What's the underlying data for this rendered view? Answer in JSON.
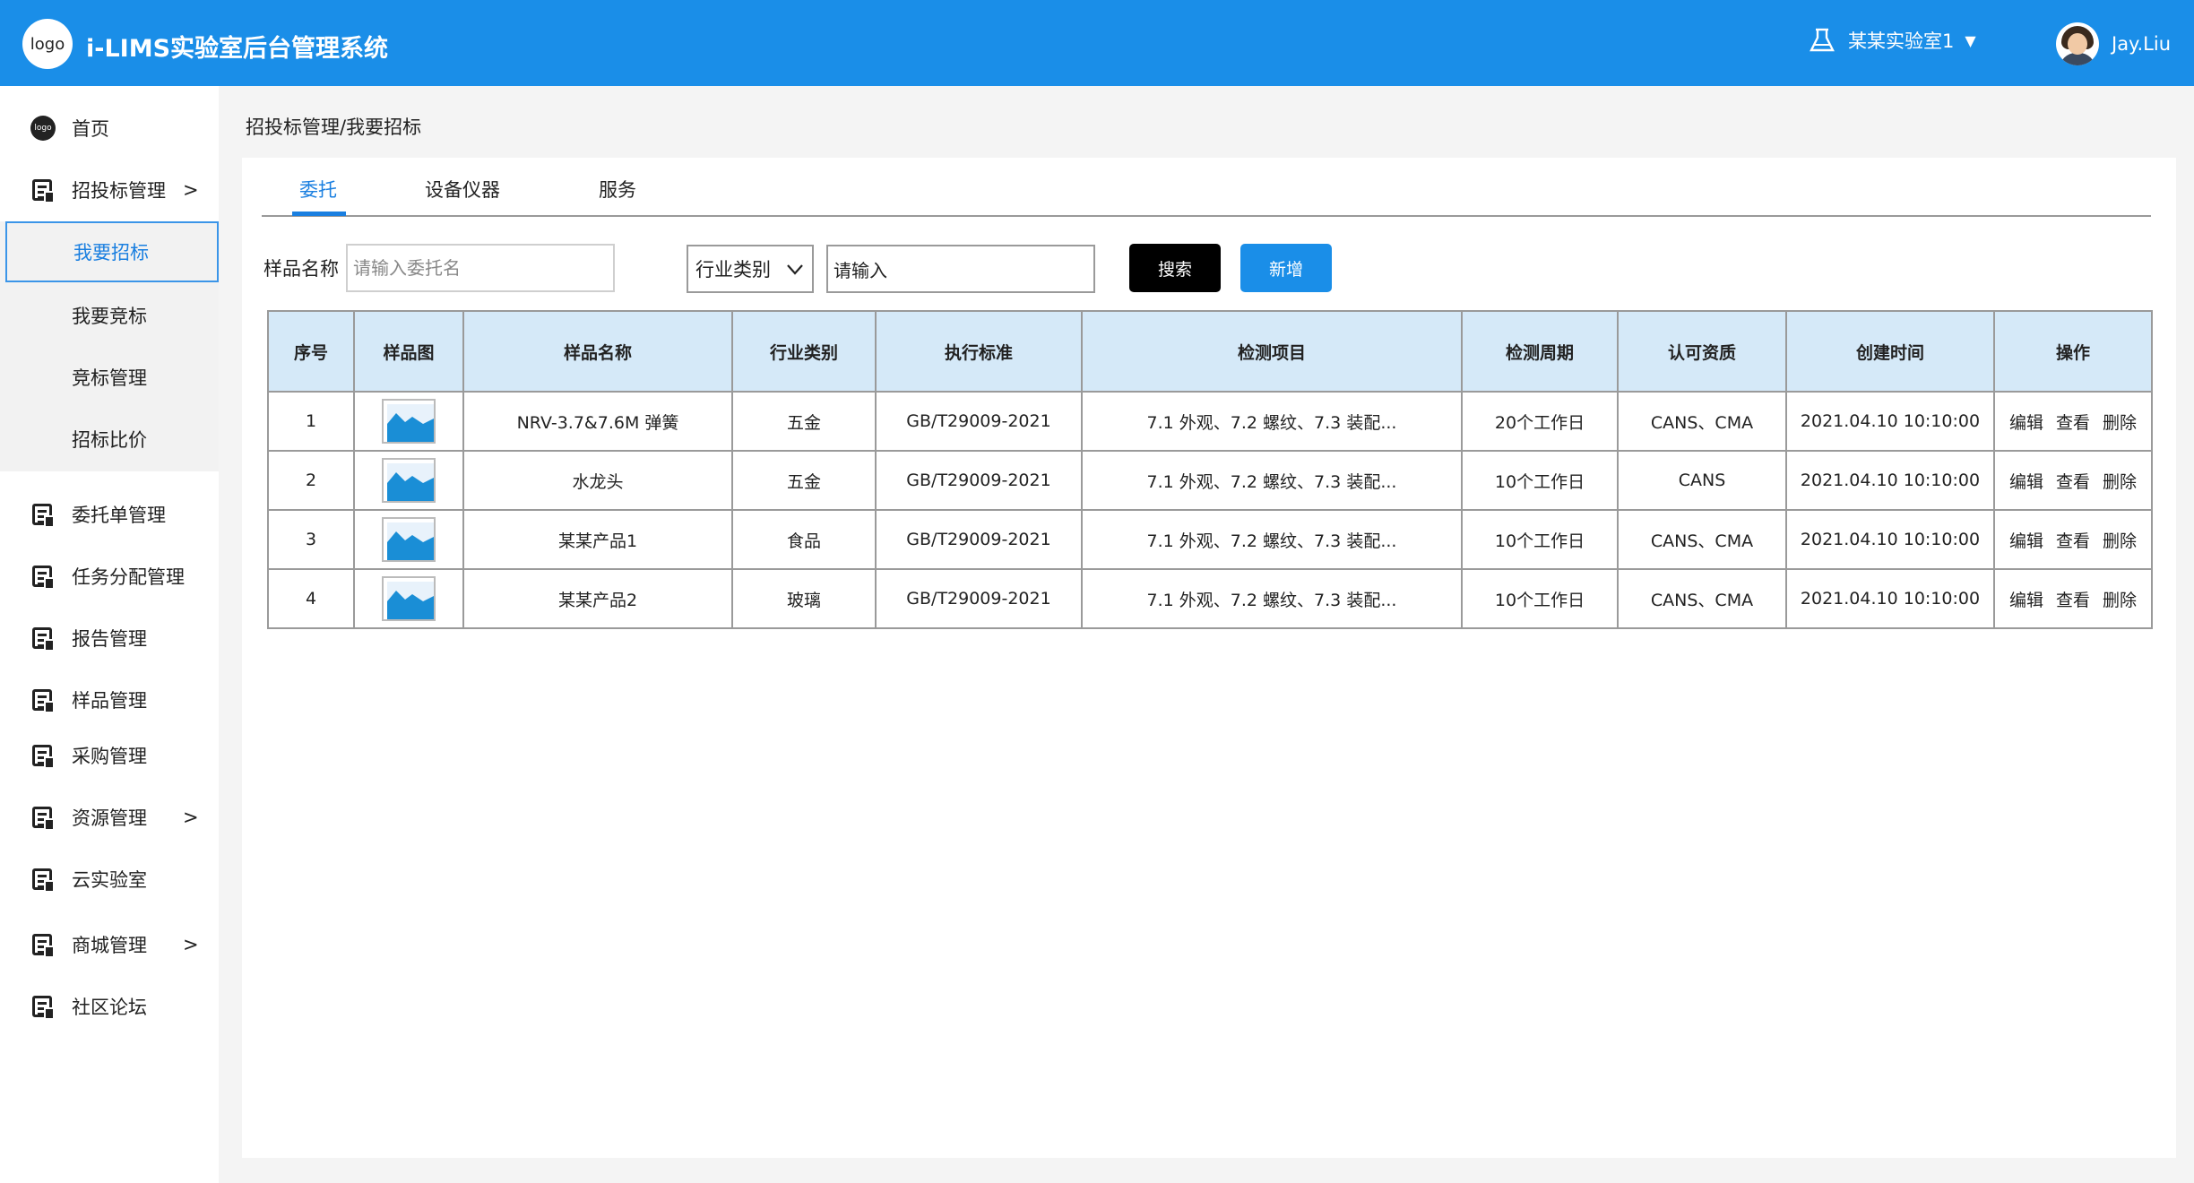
{
  "header": {
    "logo_text": "logo",
    "app_title": "i-LIMS实验室后台管理系统",
    "lab_name": "某某实验室1",
    "user_name": "Jay.Liu",
    "accent_color": "#1a8ee8"
  },
  "sidebar": {
    "items": [
      {
        "label": "首页",
        "icon": "logo-icon"
      },
      {
        "label": "招投标管理",
        "icon": "document-icon",
        "arrow": ">"
      },
      {
        "label": "委托单管理",
        "icon": "document-icon"
      },
      {
        "label": "任务分配管理",
        "icon": "document-icon"
      },
      {
        "label": "报告管理",
        "icon": "document-icon"
      },
      {
        "label": "样品管理",
        "icon": "document-icon"
      },
      {
        "label": "采购管理",
        "icon": "document-icon"
      },
      {
        "label": "资源管理",
        "icon": "document-icon",
        "arrow": ">"
      },
      {
        "label": "云实验室",
        "icon": "document-icon"
      },
      {
        "label": "商城管理",
        "icon": "document-icon",
        "arrow": ">"
      },
      {
        "label": "社区论坛",
        "icon": "document-icon"
      }
    ],
    "submenu": [
      "我要招标",
      "我要竞标",
      "竞标管理",
      "招标比价"
    ],
    "logo_dot_text": "logo"
  },
  "breadcrumb": "招投标管理/我要招标",
  "tabs": [
    "委托",
    "设备仪器",
    "服务"
  ],
  "filters": {
    "sample_label": "样品名称",
    "sample_placeholder": "请输入委托名",
    "industry_select": "行业类别",
    "industry_input_value": "请输入",
    "search_button": "搜索",
    "add_button": "新增"
  },
  "table": {
    "headers": [
      "序号",
      "样品图",
      "样品名称",
      "行业类别",
      "执行标准",
      "检测项目",
      "检测周期",
      "认可资质",
      "创建时间",
      "操作"
    ],
    "rows": [
      {
        "no": "1",
        "name": "NRV-3.7&7.6M 弹簧",
        "industry": "五金",
        "standard": "GB/T29009-2021",
        "items": "7.1 外观、7.2 螺纹、7.3 装配...",
        "cycle": "20个工作日",
        "qualification": "CANS、CMA",
        "created": "2021.04.10 10:10:00"
      },
      {
        "no": "2",
        "name": "水龙头",
        "industry": "五金",
        "standard": "GB/T29009-2021",
        "items": "7.1 外观、7.2 螺纹、7.3 装配...",
        "cycle": "10个工作日",
        "qualification": "CANS",
        "created": "2021.04.10 10:10:00"
      },
      {
        "no": "3",
        "name": "某某产品1",
        "industry": "食品",
        "standard": "GB/T29009-2021",
        "items": "7.1 外观、7.2 螺纹、7.3 装配...",
        "cycle": "10个工作日",
        "qualification": "CANS、CMA",
        "created": "2021.04.10 10:10:00"
      },
      {
        "no": "4",
        "name": "某某产品2",
        "industry": "玻璃",
        "standard": "GB/T29009-2021",
        "items": "7.1 外观、7.2 螺纹、7.3 装配...",
        "cycle": "10个工作日",
        "qualification": "CANS、CMA",
        "created": "2021.04.10 10:10:00"
      }
    ],
    "actions": [
      "编辑",
      "查看",
      "删除"
    ]
  }
}
